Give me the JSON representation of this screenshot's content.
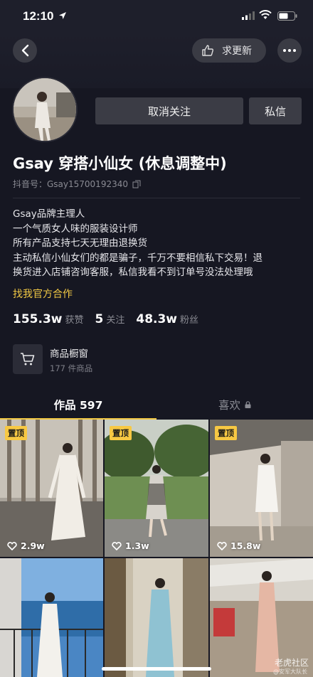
{
  "status_bar": {
    "time": "12:10"
  },
  "header": {
    "request_update_label": "求更新"
  },
  "profile": {
    "unfollow_label": "取消关注",
    "message_label": "私信",
    "name": "Gsay 穿搭小仙女 (休息调整中)",
    "douyin_id": "抖音号：Gsay15700192340",
    "bio": [
      "Gsay品牌主理人",
      "一个气质女人味的服装设计师",
      "所有产品支持七天无理由退换货",
      "主动私信小仙女们的都是骗子，千万不要相信私下交易！退",
      "换货进入店铺咨询客服，私信我看不到订单号没法处理哦"
    ],
    "cooperation_link": "找我官方合作",
    "stats": [
      {
        "value": "155.3w",
        "label": "获赞"
      },
      {
        "value": "5",
        "label": "关注"
      },
      {
        "value": "48.3w",
        "label": "粉丝"
      }
    ],
    "shop": {
      "title": "商品橱窗",
      "subtitle": "177 件商品"
    }
  },
  "tabs": [
    {
      "label": "作品 597",
      "active": true
    },
    {
      "label": "喜欢",
      "active": false,
      "locked": true
    }
  ],
  "videos": [
    {
      "pinned": true,
      "pin_label": "置顶",
      "likes": "2.9w"
    },
    {
      "pinned": true,
      "pin_label": "置顶",
      "likes": "1.3w"
    },
    {
      "pinned": true,
      "pin_label": "置顶",
      "likes": "15.8w"
    },
    {
      "pinned": false
    },
    {
      "pinned": false
    },
    {
      "pinned": false
    }
  ],
  "watermark": {
    "main": "老虎社区",
    "sub": "@安军大队长"
  },
  "colors": {
    "background": "#161722",
    "accent": "#f2c944",
    "button": "#3b3c45"
  }
}
